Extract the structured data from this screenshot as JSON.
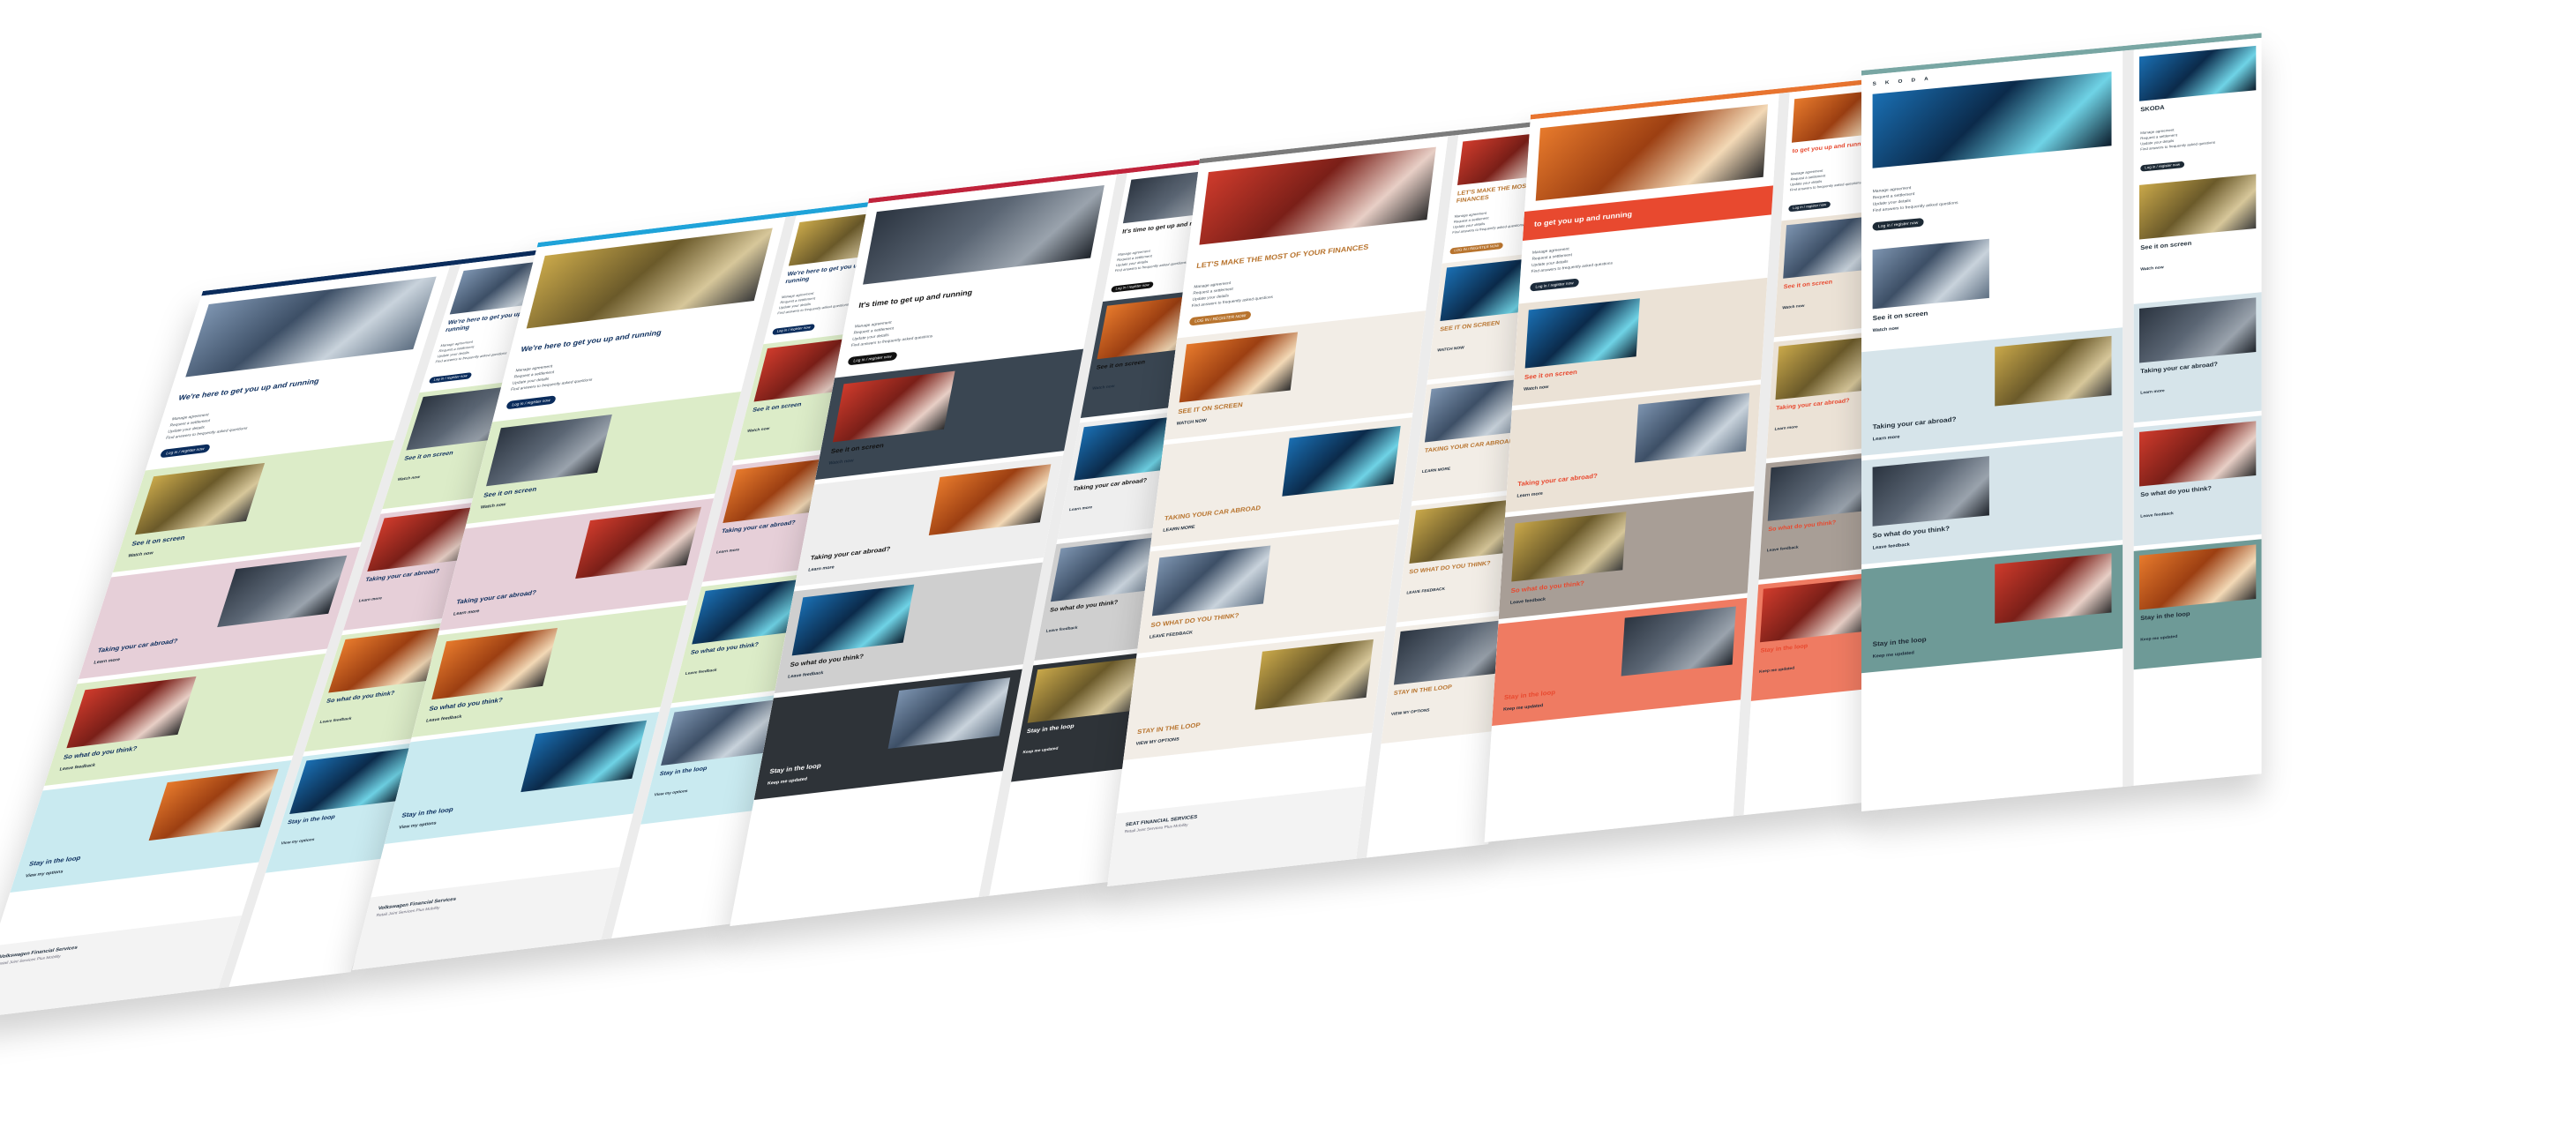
{
  "panels": [
    {
      "key": "vw",
      "accent": "#0a2c5c",
      "title_color": "#0a2c5c",
      "section_colors": [
        "#dcecc8",
        "#e6cfd8",
        "#dcecc8",
        "#c9eaf0"
      ],
      "button_color": "#0a2c5c",
      "title": "We're here to get you up and running",
      "mobile_title": "We're here to get you up and running",
      "cta": "Log in / register now",
      "bullets": [
        "Manage agreement",
        "Request a settlement",
        "Update your details",
        "Find answers to frequently asked questions"
      ],
      "sections": [
        {
          "title": "See it on screen",
          "link": "Watch now"
        },
        {
          "title": "Taking your car abroad?",
          "link": "Learn more"
        },
        {
          "title": "So what do you think?",
          "link": "Leave feedback"
        },
        {
          "title": "Stay in the loop",
          "link": "View my options"
        }
      ],
      "footer_title": "Volkswagen Financial Services",
      "footer_sub": "Retail Joint Services Plus Mobility"
    },
    {
      "key": "vw2",
      "accent": "#1fa3d9",
      "title_color": "#0a2c5c",
      "section_colors": [
        "#dcecc8",
        "#e6cfd8",
        "#dcecc8",
        "#c9eaf0"
      ],
      "button_color": "#0a2c5c",
      "title": "We're here to get you up and running",
      "mobile_title": "We're here to get you up and running",
      "cta": "Log in / register now",
      "bullets": [
        "Manage agreement",
        "Request a settlement",
        "Update your details",
        "Find answers to frequently asked questions"
      ],
      "sections": [
        {
          "title": "See it on screen",
          "link": "Watch now"
        },
        {
          "title": "Taking your car abroad?",
          "link": "Learn more"
        },
        {
          "title": "So what do you think?",
          "link": "Leave feedback"
        },
        {
          "title": "Stay in the loop",
          "link": "View my options"
        }
      ],
      "footer_title": "Volkswagen Financial Services",
      "footer_sub": "Retail Joint Services Plus Mobility"
    },
    {
      "key": "audi",
      "accent": "#c0233b",
      "title_color": "#111111",
      "section_colors": [
        "#3a4652",
        "#eeeeee",
        "#cfcfcf",
        "#2e3338"
      ],
      "button_color": "#111111",
      "title": "It's time to get up and running",
      "mobile_title": "It's time to get up and running",
      "cta": "Log in / register now",
      "bullets": [
        "Manage agreement",
        "Request a settlement",
        "Update your details",
        "Find answers to frequently asked questions"
      ],
      "sections": [
        {
          "title": "See it on screen",
          "link": "Watch now"
        },
        {
          "title": "Taking your car abroad?",
          "link": "Learn more"
        },
        {
          "title": "So what do you think?",
          "link": "Leave feedback"
        },
        {
          "title": "Stay in the loop",
          "link": "Keep me updated"
        }
      ],
      "footer_title": "",
      "footer_sub": ""
    },
    {
      "key": "cupra",
      "accent": "#7b7b7b",
      "title_color": "#b8742e",
      "section_colors": [
        "#f2ede6",
        "#f2ede6",
        "#f2ede6",
        "#f2ede6"
      ],
      "button_color": "#b8742e",
      "title": "LET'S MAKE THE MOST OF YOUR FINANCES",
      "mobile_title": "LET'S MAKE THE MOST OF YOUR FINANCES",
      "cta": "LOG IN / REGISTER NOW",
      "bullets": [
        "Manage agreement",
        "Request a settlement",
        "Update your details",
        "Find answers to frequently asked questions"
      ],
      "sections": [
        {
          "title": "SEE IT ON SCREEN",
          "link": "WATCH NOW"
        },
        {
          "title": "TAKING YOUR CAR ABROAD",
          "link": "LEARN MORE"
        },
        {
          "title": "SO WHAT DO YOU THINK?",
          "link": "LEAVE FEEDBACK"
        },
        {
          "title": "STAY IN THE LOOP",
          "link": "VIEW MY OPTIONS"
        }
      ],
      "footer_title": "SEAT FINANCIAL SERVICES",
      "footer_sub": "Retail Joint Services Plus Mobility"
    },
    {
      "key": "seat",
      "accent": "#e8742f",
      "title_color": "#e8492f",
      "section_colors": [
        "#ebe2d6",
        "#ebe2d6",
        "#a89e96",
        "#ef7b62"
      ],
      "button_color": "#1b2a3a",
      "title": "to get you up and running",
      "mobile_title": "to get you up and running",
      "cta": "Log in / register now",
      "bullets": [
        "Manage agreement",
        "Request a settlement",
        "Update your details",
        "Find answers to frequently asked questions"
      ],
      "sections": [
        {
          "title": "See it on screen",
          "link": "Watch now"
        },
        {
          "title": "Taking your car abroad?",
          "link": "Learn more"
        },
        {
          "title": "So what do you think?",
          "link": "Leave feedback"
        },
        {
          "title": "Stay in the loop",
          "link": "Keep me updated"
        }
      ],
      "footer_title": "",
      "footer_sub": ""
    },
    {
      "key": "skoda",
      "accent": "#78a6a3",
      "title_color": "#1d2a35",
      "section_colors": [
        "#ffffff",
        "#d6e4ea",
        "#d6e4ea",
        "#6e9a97"
      ],
      "button_color": "#1d2a35",
      "title": "SKODA",
      "mobile_title": "SKODA",
      "cta": "Log in / register now",
      "bullets": [
        "Manage agreement",
        "Request a settlement",
        "Update your details",
        "Find answers to frequently asked questions"
      ],
      "sections": [
        {
          "title": "See it on screen",
          "link": "Watch now"
        },
        {
          "title": "Taking your car abroad?",
          "link": "Learn more"
        },
        {
          "title": "So what do you think?",
          "link": "Leave feedback"
        },
        {
          "title": "Stay in the loop",
          "link": "Keep me updated"
        }
      ],
      "footer_title": "",
      "footer_sub": ""
    }
  ]
}
